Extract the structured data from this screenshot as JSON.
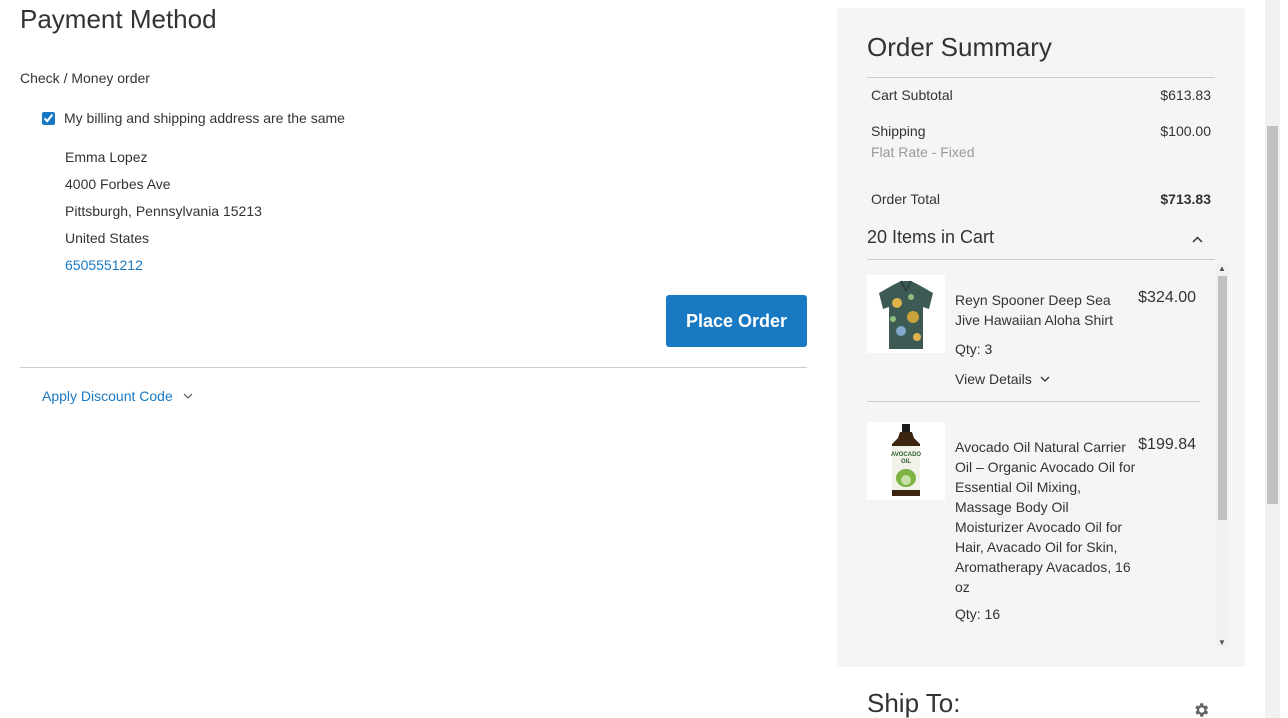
{
  "payment": {
    "title": "Payment Method",
    "method_label": "Check / Money order",
    "same_address_label": "My billing and shipping address are the same",
    "same_address_checked": true,
    "address": {
      "name": "Emma Lopez",
      "street": "4000 Forbes Ave",
      "city_line": "Pittsburgh, Pennsylvania 15213",
      "country": "United States",
      "phone": "6505551212"
    },
    "place_order_label": "Place Order",
    "discount_label": "Apply Discount Code"
  },
  "summary": {
    "title": "Order Summary",
    "subtotal_label": "Cart Subtotal",
    "subtotal_value": "$613.83",
    "shipping_label": "Shipping",
    "shipping_value": "$100.00",
    "shipping_method": "Flat Rate - Fixed",
    "total_label": "Order Total",
    "total_value": "$713.83",
    "items_count_label": "20 Items in Cart",
    "items": [
      {
        "name": "Reyn Spooner Deep Sea Jive Hawaiian Aloha Shirt",
        "price": "$324.00",
        "qty": "Qty: 3",
        "details_label": "View Details"
      },
      {
        "name": "Avocado Oil Natural Carrier Oil – Organic Avocado Oil for Essential Oil Mixing, Massage Body Oil Moisturizer Avocado Oil for Hair, Avacado Oil for Skin, Aromatherapy Avacados, 16 oz",
        "price": "$199.84",
        "qty": "Qty: 16",
        "bottle_label": "AVOCADO OIL"
      }
    ]
  },
  "ship_to": {
    "title": "Ship To:"
  },
  "colors": {
    "primary": "#1979c3",
    "summary_bg": "#f5f5f5"
  }
}
